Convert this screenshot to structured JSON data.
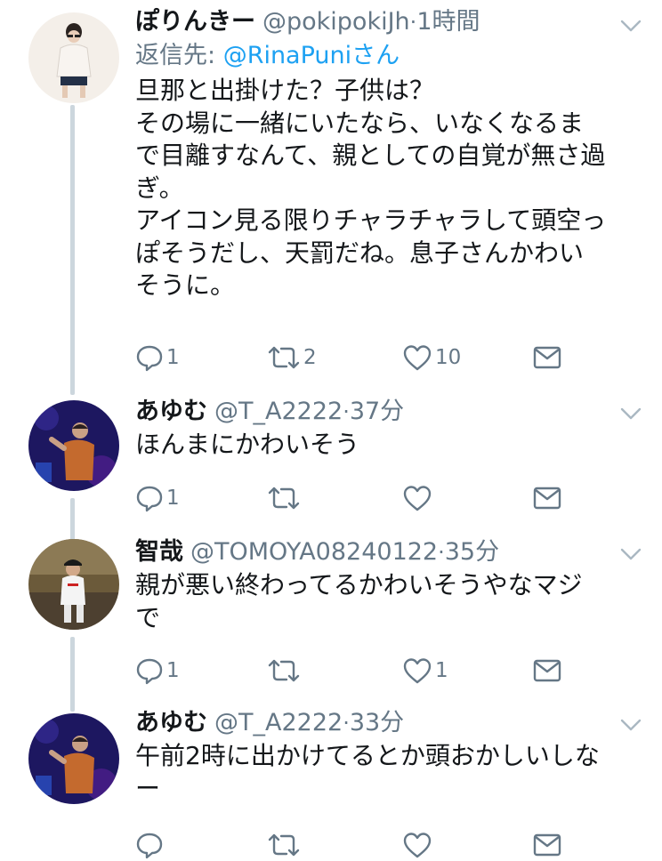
{
  "tweets": [
    {
      "display_name": "ぽりんきー",
      "handle": "@pokipokiJh",
      "separator": "·",
      "time": "1時間",
      "reply_prefix": "返信先: ",
      "reply_handle": "@RinaPuniさん",
      "lines": [
        "旦那と出掛けた？子供は？",
        "その場に一緒にいたなら、いなくなるま",
        "で目離すなんて、親としての自覚が無さ過",
        "ぎ。",
        "アイコン見る限りチャラチャラして頭空っ",
        "ぽそうだし、天罰だね。息子さんかわい",
        "そうに。"
      ],
      "reply_count": "1",
      "retweet_count": "2",
      "like_count": "10"
    },
    {
      "display_name": "あゆむ",
      "handle": "@T_A2222",
      "separator": "·",
      "time": "37分",
      "lines": [
        "ほんまにかわいそう"
      ],
      "reply_count": "1",
      "retweet_count": "",
      "like_count": ""
    },
    {
      "display_name": "智哉",
      "handle": "@TOMOYA08240122",
      "separator": "·",
      "time": "35分",
      "lines": [
        "親が悪い終わってるかわいそうやなマジ",
        "で"
      ],
      "reply_count": "1",
      "retweet_count": "",
      "like_count": "1"
    },
    {
      "display_name": "あゆむ",
      "handle": "@T_A2222",
      "separator": "·",
      "time": "33分",
      "lines": [
        "午前2時に出かけてるとか頭おかしいしな",
        "ー"
      ],
      "reply_count": "",
      "retweet_count": "",
      "like_count": ""
    }
  ],
  "icons": {
    "reply": "reply-icon",
    "retweet": "retweet-icon",
    "like": "heart-icon",
    "dm": "envelope-icon",
    "caret": "chevron-down-icon"
  },
  "colors": {
    "text": "#14171a",
    "secondary": "#657786",
    "link": "#1da1f2",
    "thread_line": "#ccd6dd"
  }
}
